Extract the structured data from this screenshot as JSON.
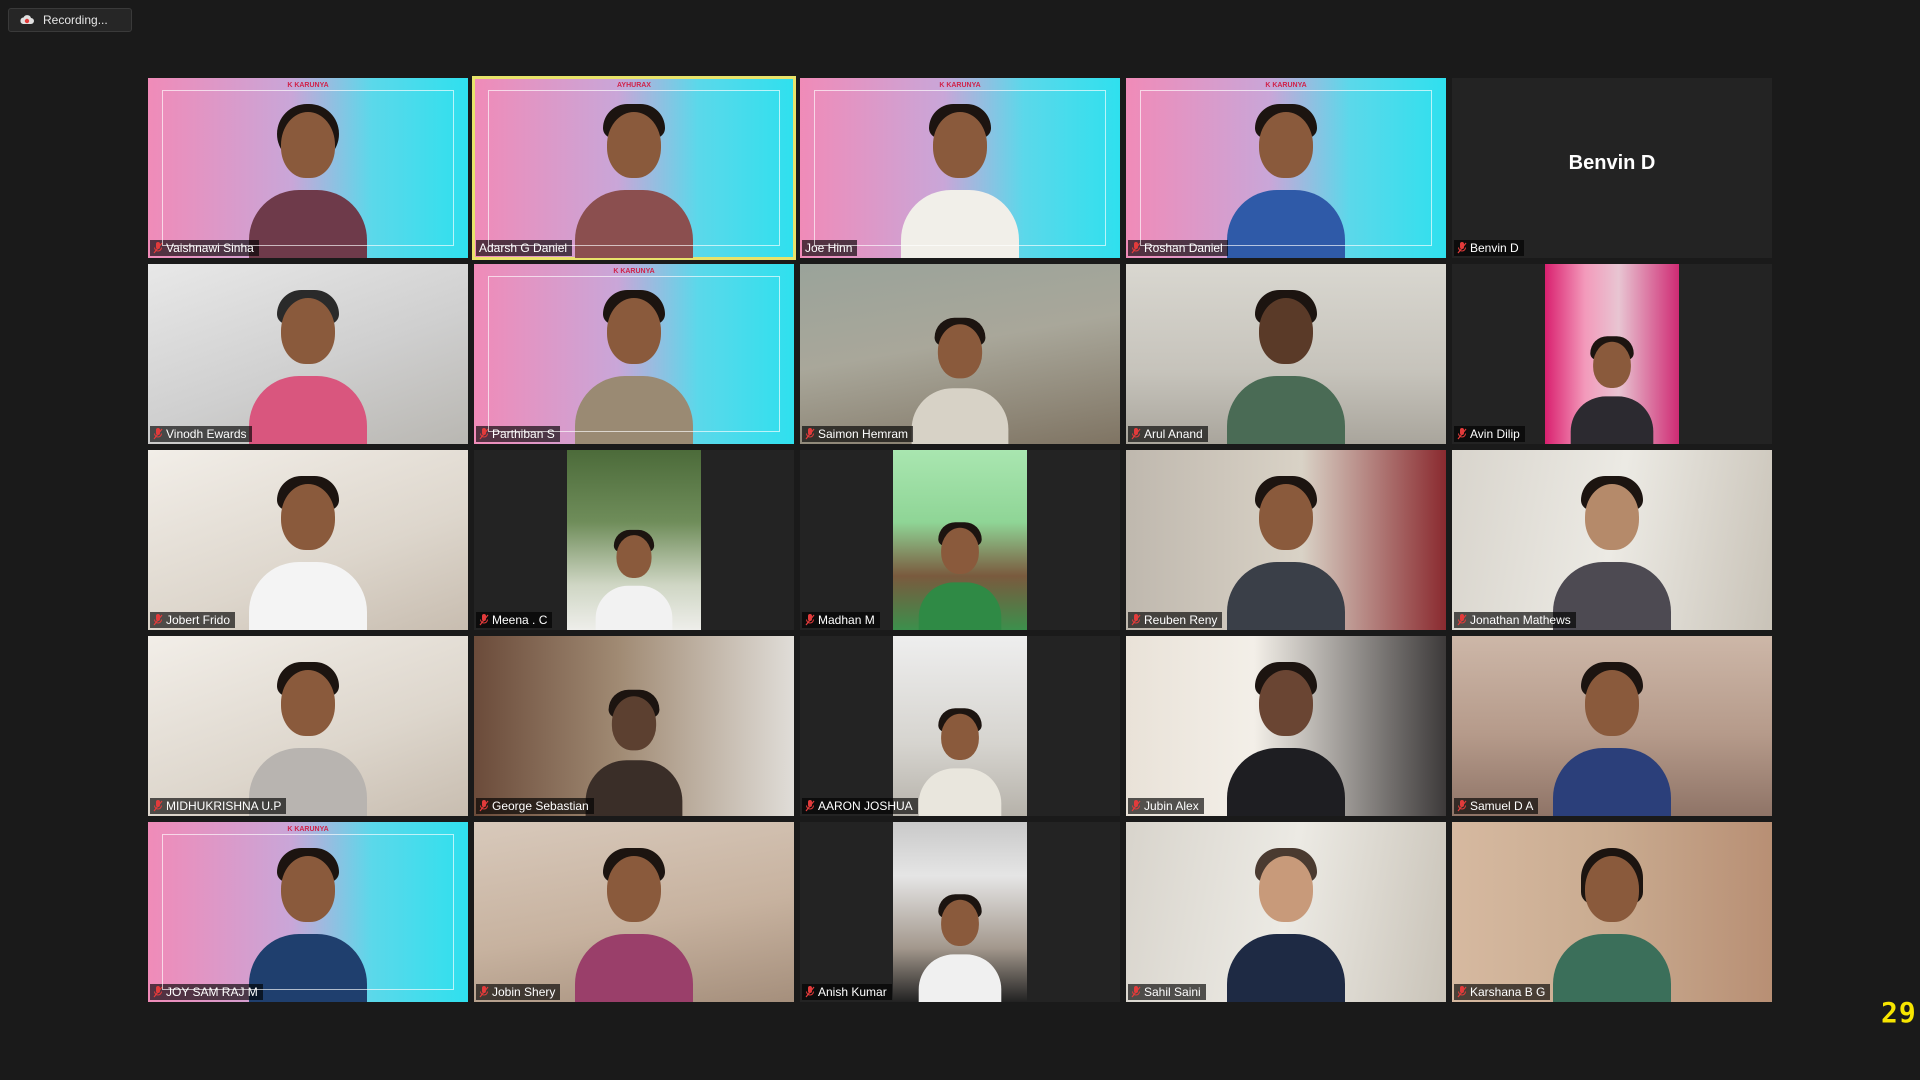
{
  "recording": {
    "label": "Recording..."
  },
  "frame_counter": "29",
  "active_speaker": "Adarsh G Daniel",
  "colors": {
    "active_border": "#e8e36a",
    "counter": "#f7e500",
    "muted_mic": "#e23b3b"
  },
  "participants": [
    {
      "name": "Vaishnawi Sinha",
      "muted": true
    },
    {
      "name": "Adarsh G Daniel",
      "muted": false,
      "brand_text": "AYHURAX"
    },
    {
      "name": "Joe Hinn",
      "muted": false
    },
    {
      "name": "Roshan Daniel",
      "muted": true
    },
    {
      "name": "Benvin D",
      "muted": true,
      "video_off": true,
      "display_name": "Benvin D"
    },
    {
      "name": "Vinodh Ewards",
      "muted": true
    },
    {
      "name": "Parthiban S",
      "muted": true
    },
    {
      "name": "Saimon Hemram",
      "muted": true
    },
    {
      "name": "Arul Anand",
      "muted": true
    },
    {
      "name": "Avin Dilip",
      "muted": true
    },
    {
      "name": "Jobert Frido",
      "muted": true
    },
    {
      "name": "Meena . C",
      "muted": true
    },
    {
      "name": "Madhan M",
      "muted": true
    },
    {
      "name": "Reuben Reny",
      "muted": true
    },
    {
      "name": "Jonathan Mathews",
      "muted": true
    },
    {
      "name": "MIDHUKRISHNA U.P",
      "muted": true
    },
    {
      "name": "George Sebastian",
      "muted": true
    },
    {
      "name": "AARON JOSHUA",
      "muted": true
    },
    {
      "name": "Jubin Alex",
      "muted": true
    },
    {
      "name": "Samuel D A",
      "muted": true
    },
    {
      "name": "JOY SAM RAJ M",
      "muted": true
    },
    {
      "name": "Jobin Shery",
      "muted": true
    },
    {
      "name": "Anish Kumar",
      "muted": true
    },
    {
      "name": "Sahil Saini",
      "muted": true
    },
    {
      "name": "Karshana B G",
      "muted": true
    }
  ]
}
